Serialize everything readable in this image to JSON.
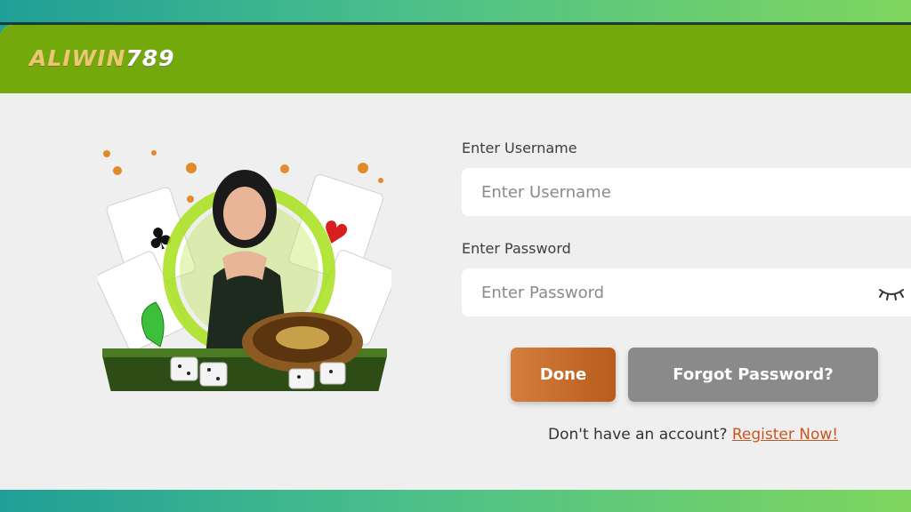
{
  "brand": {
    "logo_text_part1": "ALIWIN",
    "logo_text_part2": "789",
    "colors": {
      "header": "#74a90b",
      "accent_gold": "#e8c872",
      "panel": "#efefef"
    }
  },
  "hero": {
    "image": "casino-hostess-illustration"
  },
  "form": {
    "username_label": "Enter Username",
    "username_placeholder": "Enter Username",
    "password_label": "Enter Password",
    "password_placeholder": "Enter Password",
    "password_toggle_icon": "eye-closed-icon"
  },
  "actions": {
    "done_label": "Done",
    "forgot_label": "Forgot Password?",
    "done_color": "#c56a2a",
    "forgot_color": "#8a8a8a"
  },
  "register": {
    "prompt": "Don't have an account?",
    "link_label": "Register Now!",
    "link_color": "#c8561e"
  }
}
